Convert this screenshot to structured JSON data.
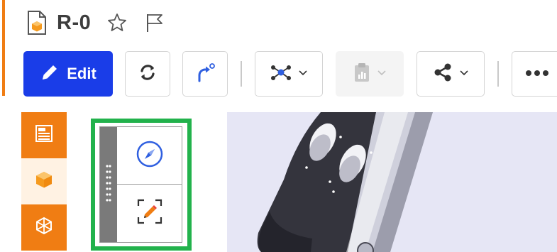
{
  "header": {
    "title": "R-0"
  },
  "toolbar": {
    "edit_label": "Edit"
  },
  "icons": {
    "document": "document-cube-icon",
    "favorite": "star-outline-icon",
    "flag": "flag-outline-icon",
    "edit": "pencil-icon",
    "refresh": "refresh-icon",
    "redirect": "curved-arrow-icon",
    "network": "network-graph-icon",
    "report": "clipboard-chart-icon",
    "share": "share-icon",
    "more": "ellipsis-icon",
    "compass": "compass-icon",
    "markup": "pencil-frame-icon"
  },
  "colors": {
    "accent": "#f07d13",
    "primary": "#1a3de8",
    "highlight": "#22b24c",
    "icon_blue": "#2f5fe0",
    "viewport_bg": "#e6e6f5"
  }
}
